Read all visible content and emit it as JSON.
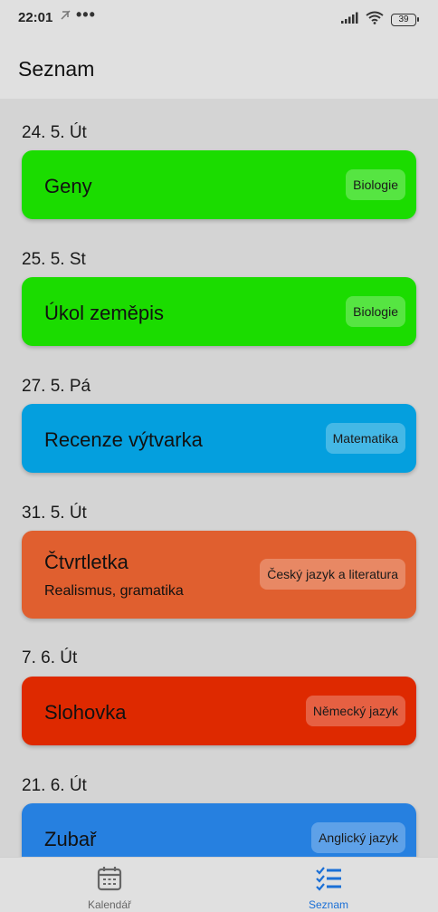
{
  "status_bar": {
    "time": "22:01",
    "dots": "•••",
    "battery": "39"
  },
  "app_bar": {
    "title": "Seznam"
  },
  "entries": [
    {
      "date": "24. 5.  Út",
      "title": "Geny",
      "subtitle": "",
      "subject": "Biologie",
      "color": "#1bdc00"
    },
    {
      "date": "25. 5.  St",
      "title": "Úkol zeměpis",
      "subtitle": "",
      "subject": "Biologie",
      "color": "#1bdc00"
    },
    {
      "date": "27. 5.  Pá",
      "title": "Recenze výtvarka",
      "subtitle": "",
      "subject": "Matematika",
      "color": "#049fde"
    },
    {
      "date": "31. 5.  Út",
      "title": "Čtvrtletka",
      "subtitle": "Realismus, gramatika",
      "subject": "Český jazyk a literatura",
      "color": "#e05f2f"
    },
    {
      "date": "7. 6.  Út",
      "title": "Slohovka",
      "subtitle": "",
      "subject": "Německý jazyk",
      "color": "#de2900"
    },
    {
      "date": "21. 6.  Út",
      "title": "Zubař",
      "subtitle": "",
      "subject": "Anglický jazyk",
      "color": "#2680e0"
    }
  ],
  "bottom_nav": {
    "items": [
      {
        "label": "Kalendář",
        "icon": "calendar-icon",
        "active": false
      },
      {
        "label": "Seznam",
        "icon": "list-checks-icon",
        "active": true
      }
    ],
    "active_color": "#1a6fd6",
    "inactive_color": "#666666"
  }
}
